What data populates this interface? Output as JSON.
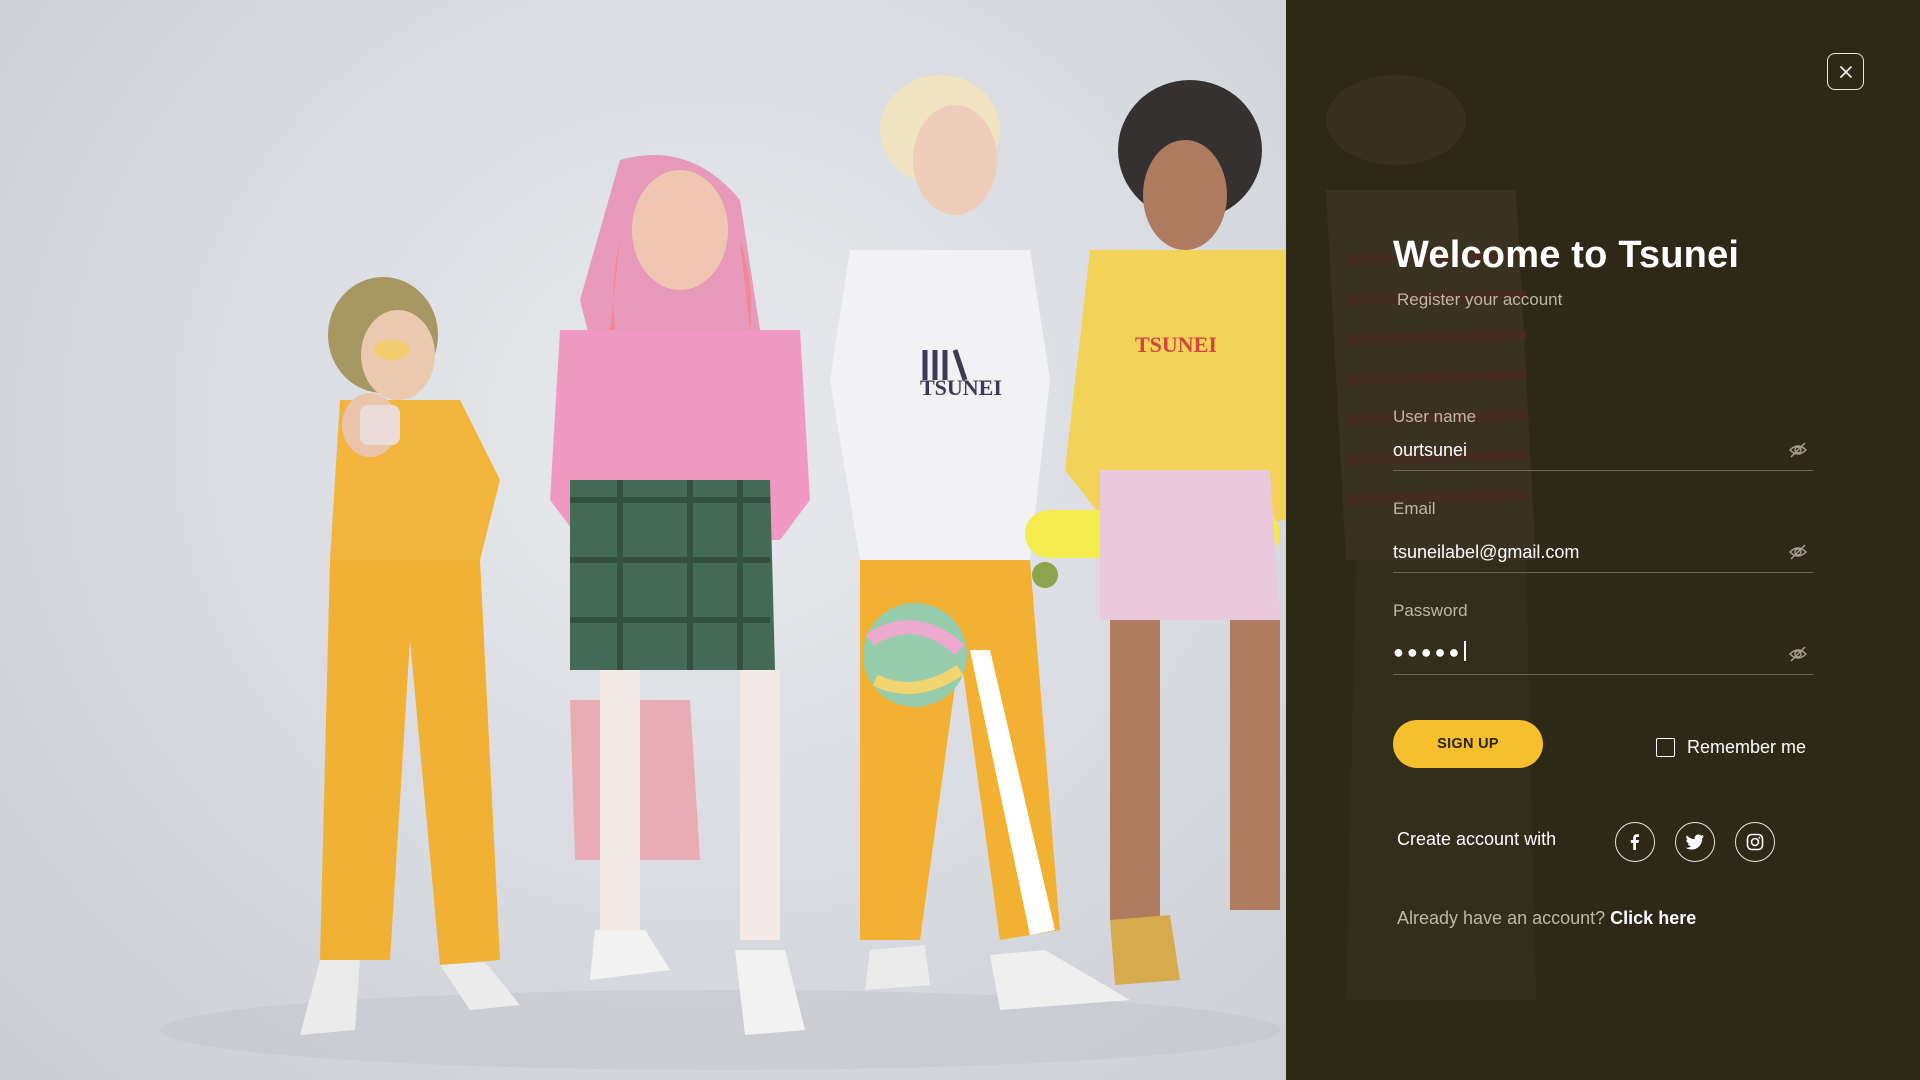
{
  "brand": {
    "accent": "#f5c02c",
    "panel_bg": "#2e2817"
  },
  "hero": {
    "image": "four-teens-fashion-photo",
    "shirt_text_1": "TSUNEI",
    "sweater_text": "TSUNEI"
  },
  "header": {
    "title": "Welcome to Tsunei",
    "subtitle": "Register your account"
  },
  "form": {
    "username": {
      "label": "User name",
      "value": "ourtsunei"
    },
    "email": {
      "label": "Email",
      "value": "tsuneilabel@gmail.com"
    },
    "password": {
      "label": "Password",
      "masked_value": "●●●●●"
    },
    "signup_label": "SIGN UP",
    "remember_label": "Remember me"
  },
  "social": {
    "label": "Create account with",
    "icons": [
      "facebook-icon",
      "twitter-icon",
      "instagram-icon"
    ]
  },
  "footer": {
    "prompt": "Already have an account?",
    "link": "Click here"
  }
}
